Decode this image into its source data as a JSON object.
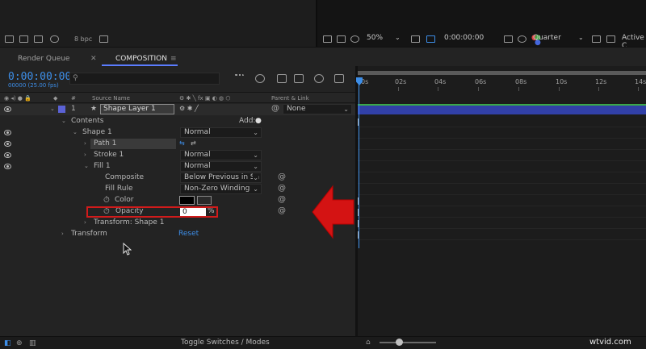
{
  "project_toolbar": {
    "bpc": "8 bpc"
  },
  "viewer_toolbar": {
    "zoom": "50%",
    "timecode": "0:00:00:00",
    "resolution": "Quarter",
    "active_camera": "Active C"
  },
  "tabs": [
    {
      "label": "Render Queue"
    },
    {
      "label": "COMPOSITION"
    }
  ],
  "timeline": {
    "timecode": "0:00:00:00",
    "frame_fps": "00000 (25.00 fps)",
    "search_placeholder": "",
    "columns": {
      "num": "#",
      "source_name": "Source Name",
      "parent_link": "Parent & Link"
    },
    "ruler": [
      "0s",
      "02s",
      "04s",
      "06s",
      "08s",
      "10s",
      "12s",
      "14s"
    ]
  },
  "layers": {
    "layer": {
      "number": "1",
      "name": "Shape Layer 1",
      "parent": "None"
    },
    "contents": "Contents",
    "add": "Add:",
    "shape": {
      "name": "Shape 1",
      "mode": "Normal"
    },
    "path": "Path 1",
    "stroke": {
      "name": "Stroke 1",
      "mode": "Normal"
    },
    "fill": {
      "name": "Fill 1",
      "mode": "Normal"
    },
    "composite": {
      "label": "Composite",
      "value": "Below Previous in Sa"
    },
    "fill_rule": {
      "label": "Fill Rule",
      "value": "Non-Zero Winding"
    },
    "color": {
      "label": "Color"
    },
    "opacity": {
      "label": "Opacity",
      "value": "0",
      "unit": "%"
    },
    "transform_shape": "Transform: Shape 1",
    "transform": "Transform",
    "reset": "Reset"
  },
  "status_bar": {
    "toggle": "Toggle Switches / Modes"
  },
  "watermark": "wtvid.com",
  "colors": {
    "accent_blue": "#3d8ee8",
    "layer_bar": "#3140a8",
    "highlight_red": "#d11b1b"
  }
}
